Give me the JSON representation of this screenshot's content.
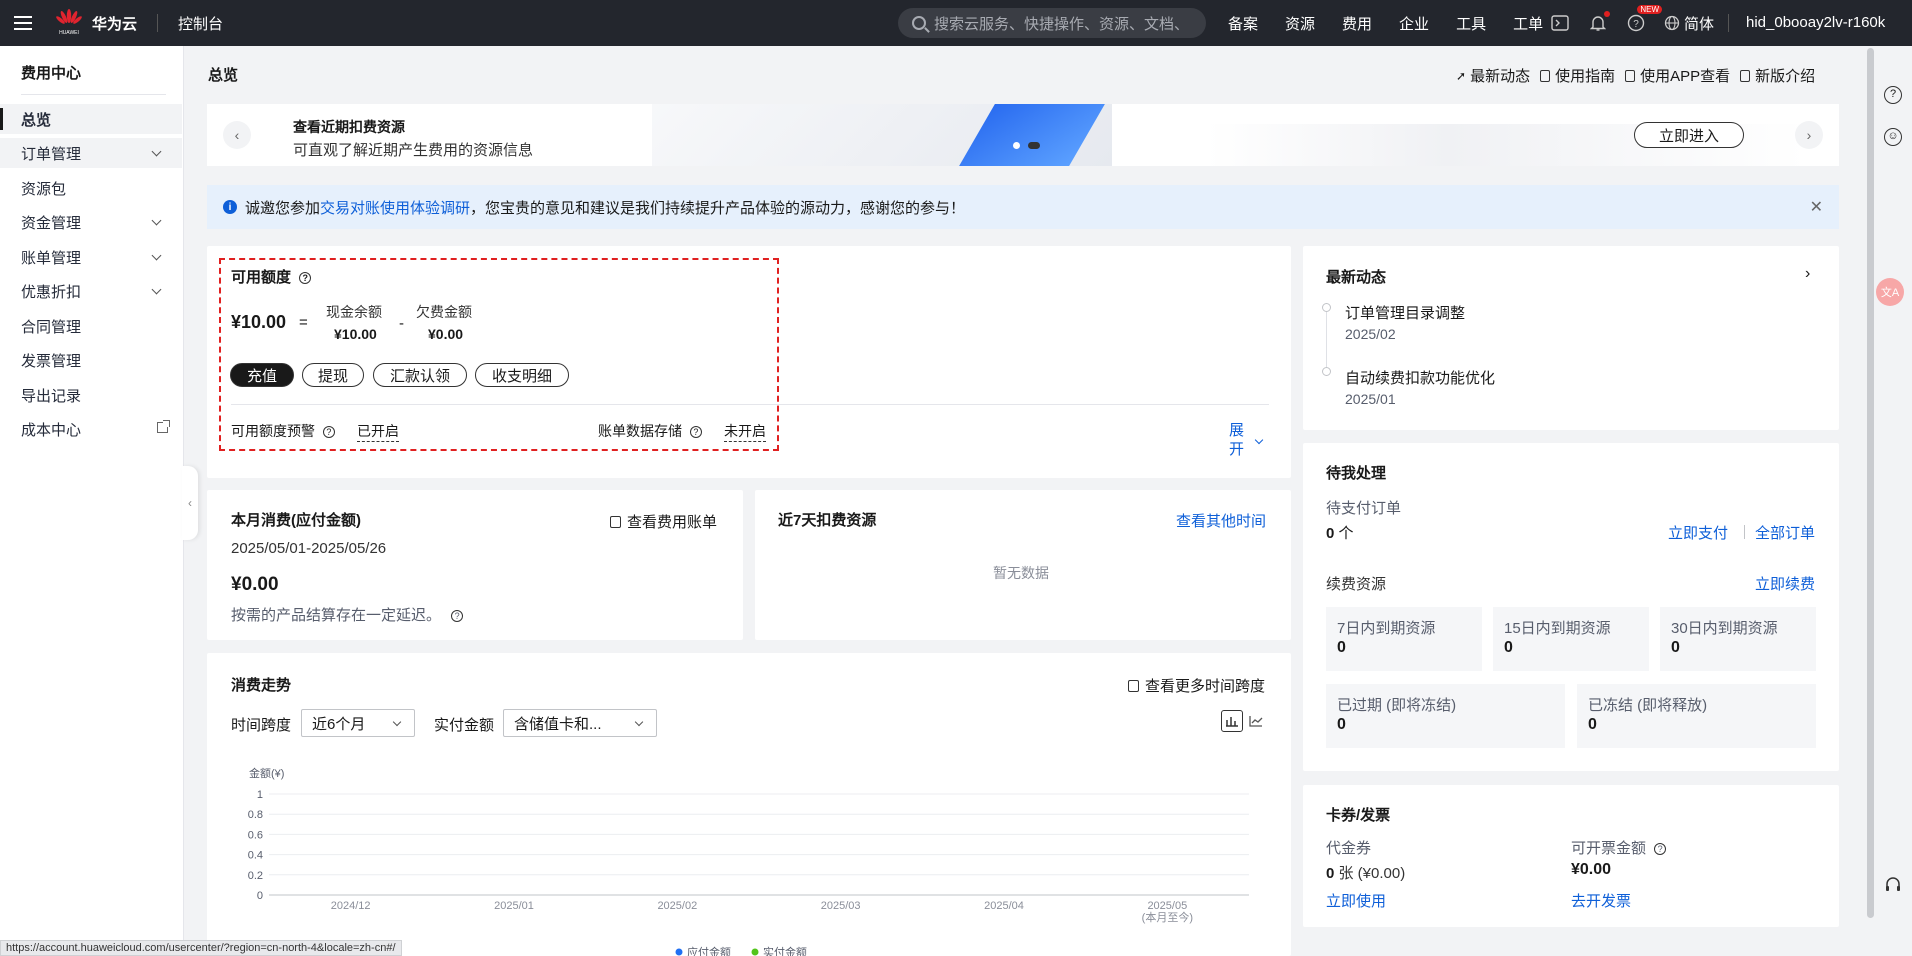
{
  "topbar": {
    "brand_small": "HUAWEI",
    "brand": "华为云",
    "console": "控制台",
    "search_placeholder": "搜索云服务、快捷操作、资源、文档、",
    "nav": [
      "备案",
      "资源",
      "费用",
      "企业",
      "工具",
      "工单"
    ],
    "new_badge": "NEW",
    "lang": "简体",
    "user": "hid_0booay2lv-r160k"
  },
  "sidebar": {
    "title": "费用中心",
    "items": [
      {
        "label": "总览"
      },
      {
        "label": "订单管理"
      },
      {
        "label": "资源包"
      },
      {
        "label": "资金管理"
      },
      {
        "label": "账单管理"
      },
      {
        "label": "优惠折扣"
      },
      {
        "label": "合同管理"
      },
      {
        "label": "发票管理"
      },
      {
        "label": "导出记录"
      },
      {
        "label": "成本中心"
      }
    ]
  },
  "page": {
    "title": "总览",
    "quicklinks": [
      "最新动态",
      "使用指南",
      "使用APP查看",
      "新版介绍"
    ]
  },
  "banner": {
    "title": "查看近期扣费资源",
    "subtitle": "可直观了解近期产生费用的资源信息",
    "button": "立即进入"
  },
  "notice": {
    "prefix": "诚邀您参加",
    "link": "交易对账使用体验调研",
    "suffix": "，您宝贵的意见和建议是我们持续提升产品体验的源动力，感谢您的参与！"
  },
  "balance": {
    "title": "可用额度",
    "available": "¥10.00",
    "eq": "=",
    "cash_label": "现金余额",
    "cash_value": "¥10.00",
    "minus": "-",
    "debt_label": "欠费金额",
    "debt_value": "¥0.00",
    "buttons": [
      "充值",
      "提现",
      "汇款认领",
      "收支明细"
    ],
    "alert_label": "可用额度预警",
    "alert_value": "已开启",
    "storage_label": "账单数据存储",
    "storage_value": "未开启",
    "expand_1": "展",
    "expand_2": "开"
  },
  "monthly": {
    "title": "本月消费(应付金额)",
    "link": "查看费用账单",
    "period": "2025/05/01-2025/05/26",
    "amount": "¥0.00",
    "note": "按需的产品结算存在一定延迟。"
  },
  "recent7": {
    "title": "近7天扣费资源",
    "link": "查看其他时间",
    "empty": "暂无数据"
  },
  "trend": {
    "title": "消费走势",
    "link": "查看更多时间跨度",
    "span_label": "时间跨度",
    "span_value": "近6个月",
    "amount_label": "实付金额",
    "amount_value": "含储值卡和..."
  },
  "chart_data": {
    "type": "bar",
    "categories": [
      "2024/12",
      "2025/01",
      "2025/02",
      "2025/03",
      "2025/04",
      "2025/05"
    ],
    "category_sublabels": [
      "",
      "",
      "",
      "",
      "",
      "(本月至今)"
    ],
    "ylabel": "金额(¥)",
    "yticks": [
      "0",
      "0.2",
      "0.4",
      "0.6",
      "0.8",
      "1"
    ],
    "ylim": [
      0,
      1
    ],
    "grid": true,
    "series": [
      {
        "name": "应付金额",
        "values": [
          0,
          0,
          0,
          0,
          0,
          0
        ],
        "color": "#2070f3"
      },
      {
        "name": "实付金额",
        "values": [
          0,
          0,
          0,
          0,
          0,
          0
        ],
        "color": "#52c41a"
      }
    ]
  },
  "news": {
    "title": "最新动态",
    "items": [
      {
        "title": "订单管理目录调整",
        "date": "2025/02"
      },
      {
        "title": "自动续费扣款功能优化",
        "date": "2025/01"
      }
    ]
  },
  "todo": {
    "title": "待我处理",
    "pending_label": "待支付订单",
    "pending_count": "0",
    "pending_unit": "个",
    "pay_link": "立即支付",
    "all_link": "全部订单",
    "renew_label": "续费资源",
    "renew_link": "立即续费",
    "boxes": [
      {
        "label": "7日内到期资源",
        "value": "0"
      },
      {
        "label": "15日内到期资源",
        "value": "0"
      },
      {
        "label": "30日内到期资源",
        "value": "0"
      },
      {
        "label": "已过期 (即将冻结)",
        "value": "0"
      },
      {
        "label": "已冻结 (即将释放)",
        "value": "0"
      }
    ]
  },
  "voucher": {
    "title": "卡券/发票",
    "coupon_label": "代金券",
    "coupon_count": "0",
    "coupon_detail": "张 (¥0.00)",
    "coupon_link": "立即使用",
    "invoice_label": "可开票金额",
    "invoice_value": "¥0.00",
    "invoice_link": "去开发票"
  },
  "statusbar": "https://account.huaweicloud.com/usercenter/?region=cn-north-4&locale=zh-cn#/"
}
